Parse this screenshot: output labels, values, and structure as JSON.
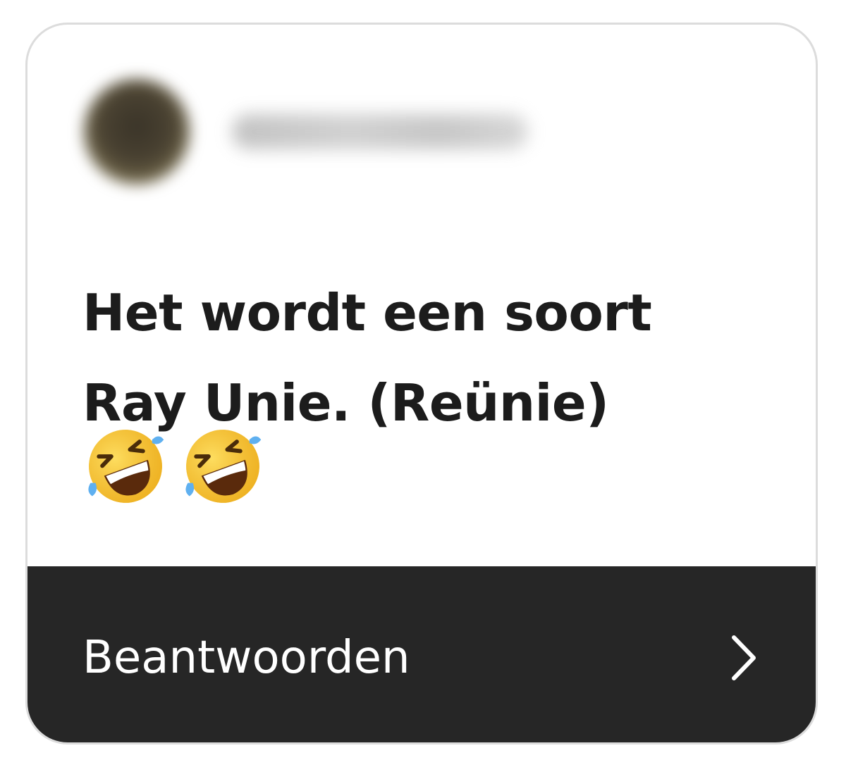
{
  "sender": {
    "username": "hidden_user",
    "avatar_icon": "user-avatar"
  },
  "message": {
    "lines": [
      "Het wordt een soort",
      "Ray Unie. (Reünie)"
    ],
    "emojis": [
      "🤣",
      "🤣"
    ]
  },
  "footer": {
    "reply_label": "Beantwoorden",
    "chevron_icon": "chevron-right-icon"
  },
  "colors": {
    "footer_bg": "#262626",
    "text": "#1c1c1c",
    "card_border": "#dcdcdc"
  }
}
